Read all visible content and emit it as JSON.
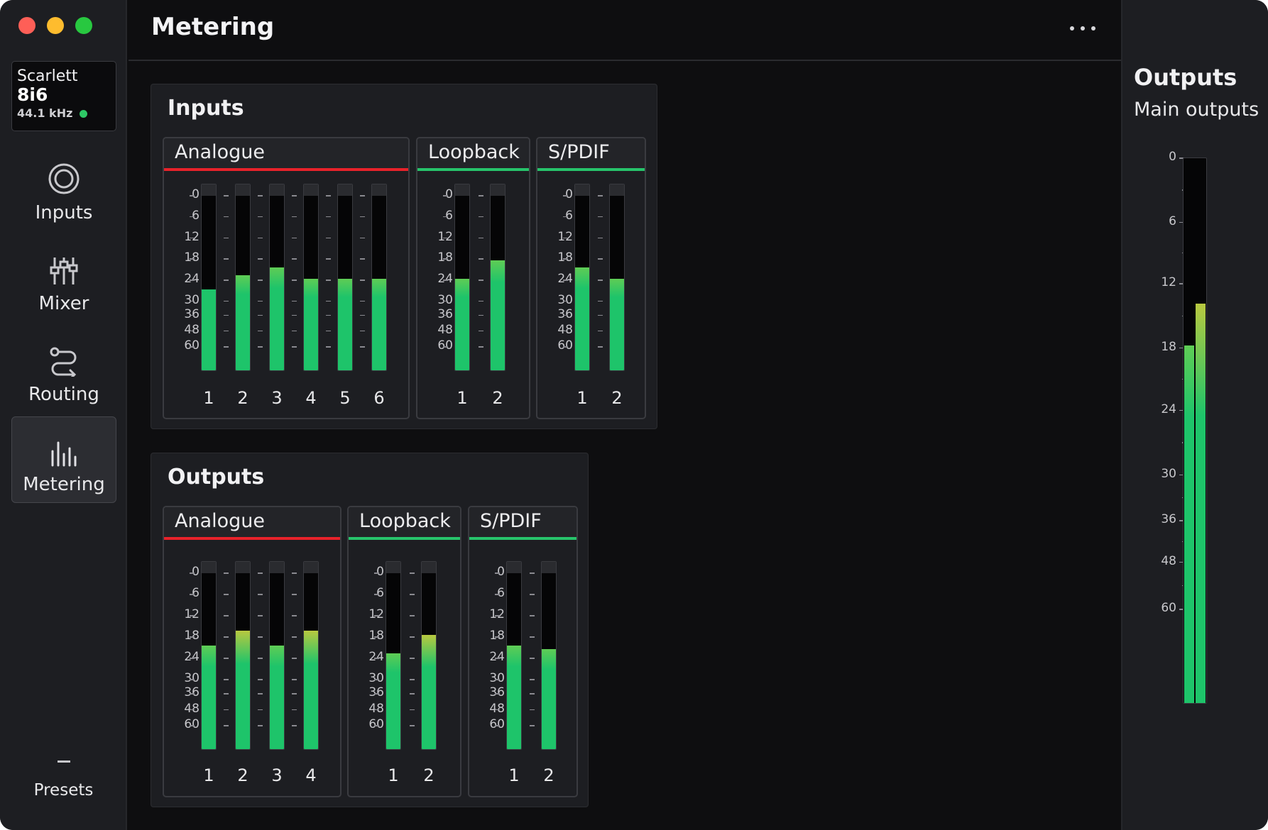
{
  "device": {
    "brand": "Scarlett",
    "model": "8i6",
    "sample_rate": "44.1 kHz"
  },
  "nav": [
    {
      "id": "inputs",
      "label": "Inputs",
      "icon": "inputs-ring-icon"
    },
    {
      "id": "mixer",
      "label": "Mixer",
      "icon": "mixer-faders-icon"
    },
    {
      "id": "routing",
      "label": "Routing",
      "icon": "routing-icon"
    },
    {
      "id": "metering",
      "label": "Metering",
      "icon": "metering-bars-icon",
      "active": true
    }
  ],
  "presets_label": "Presets",
  "page_title": "Metering",
  "scale": [
    "0",
    "6",
    "12",
    "18",
    "24",
    "30",
    "36",
    "48",
    "60"
  ],
  "inputs": {
    "title": "Inputs",
    "groups": [
      {
        "name": "Analogue",
        "accent": "#e8222a",
        "channels": [
          "1",
          "2",
          "3",
          "4",
          "5",
          "6"
        ],
        "levels_db": [
          -24,
          -20,
          -18,
          -21,
          -21,
          -21
        ]
      },
      {
        "name": "Loopback",
        "accent": "#27c46b",
        "channels": [
          "1",
          "2"
        ],
        "levels_db": [
          -21,
          -16
        ]
      },
      {
        "name": "S/PDIF",
        "accent": "#27c46b",
        "channels": [
          "1",
          "2"
        ],
        "levels_db": [
          -18,
          -21
        ]
      }
    ]
  },
  "outputs": {
    "title": "Outputs",
    "groups": [
      {
        "name": "Analogue",
        "accent": "#e8222a",
        "channels": [
          "1",
          "2",
          "3",
          "4"
        ],
        "levels_db": [
          -18,
          -14,
          -18,
          -14
        ]
      },
      {
        "name": "Loopback",
        "accent": "#27c46b",
        "channels": [
          "1",
          "2"
        ],
        "levels_db": [
          -20,
          -15
        ]
      },
      {
        "name": "S/PDIF",
        "accent": "#27c46b",
        "channels": [
          "1",
          "2"
        ],
        "levels_db": [
          -18,
          -19
        ]
      }
    ]
  },
  "main_outputs": {
    "title": "Outputs",
    "subtitle": "Main outputs",
    "scale": [
      "0",
      "6",
      "12",
      "18",
      "24",
      "30",
      "36",
      "48",
      "60"
    ],
    "levels_db": [
      -18,
      -14
    ]
  },
  "colors": {
    "meter_green": "#1ec46a",
    "meter_yellow": "#b8c840",
    "close": "#fe5f57",
    "minimize": "#febc2e",
    "zoom": "#28c840"
  }
}
